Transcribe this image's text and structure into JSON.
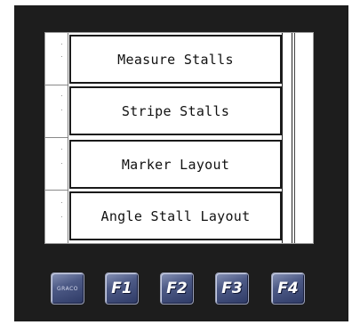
{
  "menu": {
    "items": [
      {
        "label": "Measure Stalls"
      },
      {
        "label": "Stripe Stalls"
      },
      {
        "label": "Marker Layout"
      },
      {
        "label": "Angle Stall Layout"
      }
    ]
  },
  "function_keys": {
    "logo_label": "GRACO",
    "f1": "F1",
    "f2": "F2",
    "f3": "F3",
    "f4": "F4"
  },
  "colors": {
    "bezel": "#1d1d1d",
    "screen": "#ffffff",
    "key_face": "#4d5a86"
  }
}
